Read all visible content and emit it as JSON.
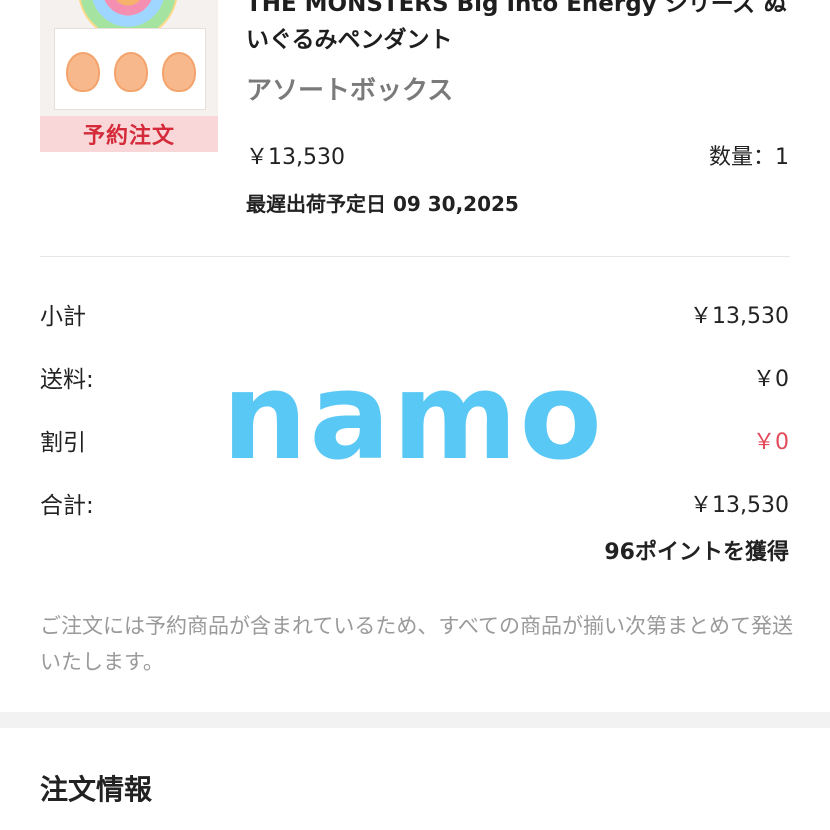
{
  "product": {
    "title": "THE MONSTERS Big Into Energy シリーズ ぬいぐるみペンダント",
    "variant": "アソートボックス",
    "price": "￥13,530",
    "quantity": "数量：1",
    "latest_ship_date": "最遅出荷予定日 09 30,2025",
    "badge": "予約注文"
  },
  "summary": {
    "subtotal_label": "小計",
    "subtotal_value": "￥13,530",
    "shipping_label": "送料:",
    "shipping_value": "￥0",
    "discount_label": "割引",
    "discount_value": "￥0",
    "total_label": "合計:",
    "total_value": "￥13,530",
    "points": "96ポイントを獲得"
  },
  "note": "ご注文には予約商品が含まれているため、すべての商品が揃い次第まとめて発送いたします。",
  "order_info": {
    "title": "注文情報"
  },
  "watermark": "namo",
  "colors": {
    "badge_bg": "#f9d7d8",
    "badge_text": "#d42a39",
    "discount": "#e24a5a",
    "watermark": "#5ac8f5"
  }
}
